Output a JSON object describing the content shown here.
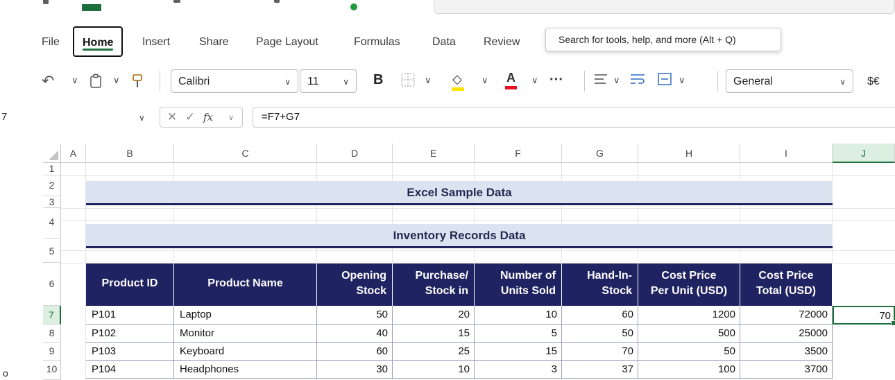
{
  "ribbon_tabs": [
    "File",
    "Home",
    "Insert",
    "Share",
    "Page Layout",
    "Formulas",
    "Data",
    "Review"
  ],
  "active_tab": "Home",
  "tooltip": "Search for tools, help, and more (Alt + Q)",
  "toolbar": {
    "font_name": "Calibri",
    "font_size": "11",
    "bold_label": "B",
    "more_label": "···",
    "number_format": "General",
    "currency_label": "$€"
  },
  "formula_bar": {
    "name_box": "7",
    "fx_label": "fx",
    "formula": "=F7+G7"
  },
  "sheet": {
    "columns": [
      "A",
      "B",
      "C",
      "D",
      "E",
      "F",
      "G",
      "H",
      "I",
      "J"
    ],
    "selected_column": "J",
    "rows": [
      "1",
      "2",
      "3",
      "4",
      "5",
      "6",
      "7",
      "8",
      "9",
      "10"
    ],
    "selected_row": "7",
    "title": "Excel Sample Data",
    "subtitle": "Inventory Records Data",
    "headers": [
      [
        "Product ID"
      ],
      [
        "Product Name"
      ],
      [
        "Opening",
        "Stock"
      ],
      [
        "Purchase/",
        "Stock in"
      ],
      [
        "Number of",
        "Units Sold"
      ],
      [
        "Hand-In-",
        "Stock"
      ],
      [
        "Cost Price",
        "Per Unit (USD)"
      ],
      [
        "Cost Price",
        "Total (USD)"
      ]
    ],
    "data_rows": [
      [
        "P101",
        "Laptop",
        "50",
        "20",
        "10",
        "60",
        "1200",
        "72000"
      ],
      [
        "P102",
        "Monitor",
        "40",
        "15",
        "5",
        "50",
        "500",
        "25000"
      ],
      [
        "P103",
        "Keyboard",
        "60",
        "25",
        "15",
        "70",
        "50",
        "3500"
      ],
      [
        "P104",
        "Headphones",
        "30",
        "10",
        "3",
        "37",
        "100",
        "3700"
      ]
    ],
    "active_cell_value": "70"
  },
  "bullet": "o",
  "colors": {
    "header_fill": "#1f2361",
    "title_band": "#dce3f0",
    "selection": "#1e6f3e"
  }
}
